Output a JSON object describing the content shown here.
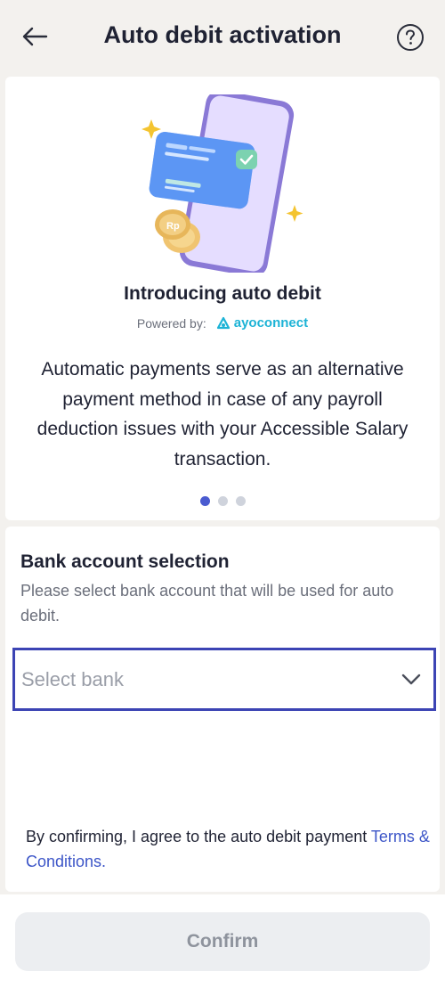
{
  "header": {
    "title": "Auto debit activation",
    "back_icon": "arrow-left-icon",
    "help_icon": "question-circle-icon"
  },
  "intro": {
    "title": "Introducing auto debit",
    "powered_by_label": "Powered by:",
    "brand_name": "ayoconnect",
    "description": "Automatic payments serve as an alternative payment method in case of any payroll deduction issues with your Accessible Salary transaction.",
    "illustration_coin_text": "Rp",
    "carousel": {
      "total": 3,
      "active_index": 0
    }
  },
  "bank_section": {
    "title": "Bank account selection",
    "description": "Please select bank account that will be used for auto debit.",
    "select_placeholder": "Select bank"
  },
  "consent": {
    "text": "By confirming, I agree to the auto debit payment ",
    "link_text": "Terms & Conditions."
  },
  "footer": {
    "confirm_label": "Confirm"
  },
  "colors": {
    "accent": "#3c44b4",
    "link": "#3d56c8",
    "brand": "#1db3d6",
    "background": "#f3f1ee"
  }
}
